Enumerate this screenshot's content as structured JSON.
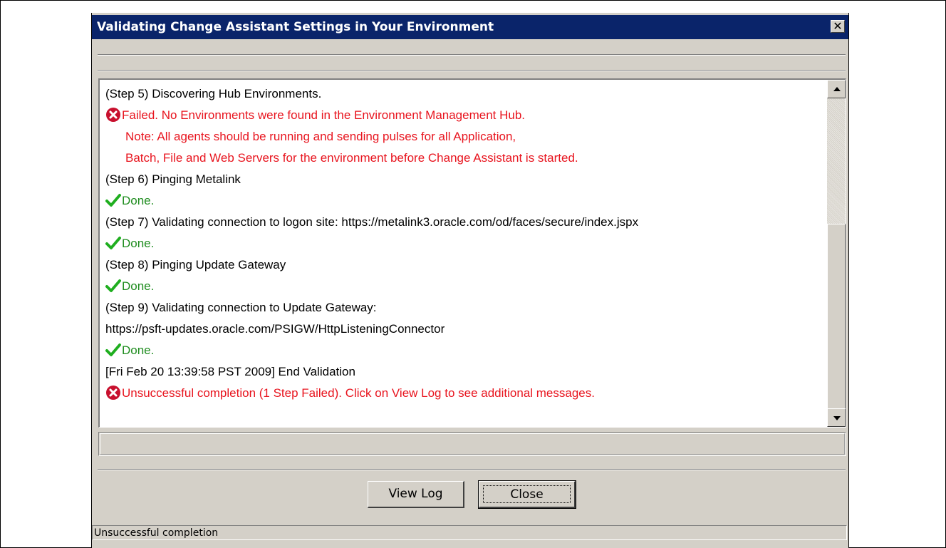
{
  "window": {
    "title": "Validating Change Assistant Settings in Your Environment"
  },
  "log": [
    {
      "kind": "text",
      "text": "(Step 5) Discovering Hub Environments."
    },
    {
      "kind": "error",
      "text": "Failed.   No Environments were found in the Environment Management Hub."
    },
    {
      "kind": "error-indent",
      "text": "Note: All agents should be running and sending pulses for all Application,"
    },
    {
      "kind": "error-indent",
      "text": "Batch, File and Web Servers for the environment before Change Assistant is started."
    },
    {
      "kind": "text",
      "text": "(Step 6) Pinging Metalink"
    },
    {
      "kind": "ok",
      "text": "Done."
    },
    {
      "kind": "text",
      "text": "(Step 7) Validating connection to logon site: https://metalink3.oracle.com/od/faces/secure/index.jspx"
    },
    {
      "kind": "ok",
      "text": "Done."
    },
    {
      "kind": "text",
      "text": "(Step 8) Pinging Update Gateway"
    },
    {
      "kind": "ok",
      "text": "Done."
    },
    {
      "kind": "text",
      "text": "(Step 9) Validating connection to Update Gateway:"
    },
    {
      "kind": "text",
      "text": "https://psft-updates.oracle.com/PSIGW/HttpListeningConnector"
    },
    {
      "kind": "ok",
      "text": "Done."
    },
    {
      "kind": "text",
      "text": "[Fri Feb 20 13:39:58 PST 2009] End Validation"
    },
    {
      "kind": "error",
      "text": "Unsuccessful completion (1 Step Failed).  Click on View Log to see additional messages."
    }
  ],
  "buttons": {
    "view_log": "View Log",
    "close": "Close"
  },
  "status": {
    "text": "Unsuccessful completion"
  },
  "colors": {
    "error": "#e8141e",
    "ok": "#1e8c1e",
    "titlebar": "#0a246a"
  },
  "icons": {
    "error": "error-circle-icon",
    "ok": "checkmark-icon"
  }
}
